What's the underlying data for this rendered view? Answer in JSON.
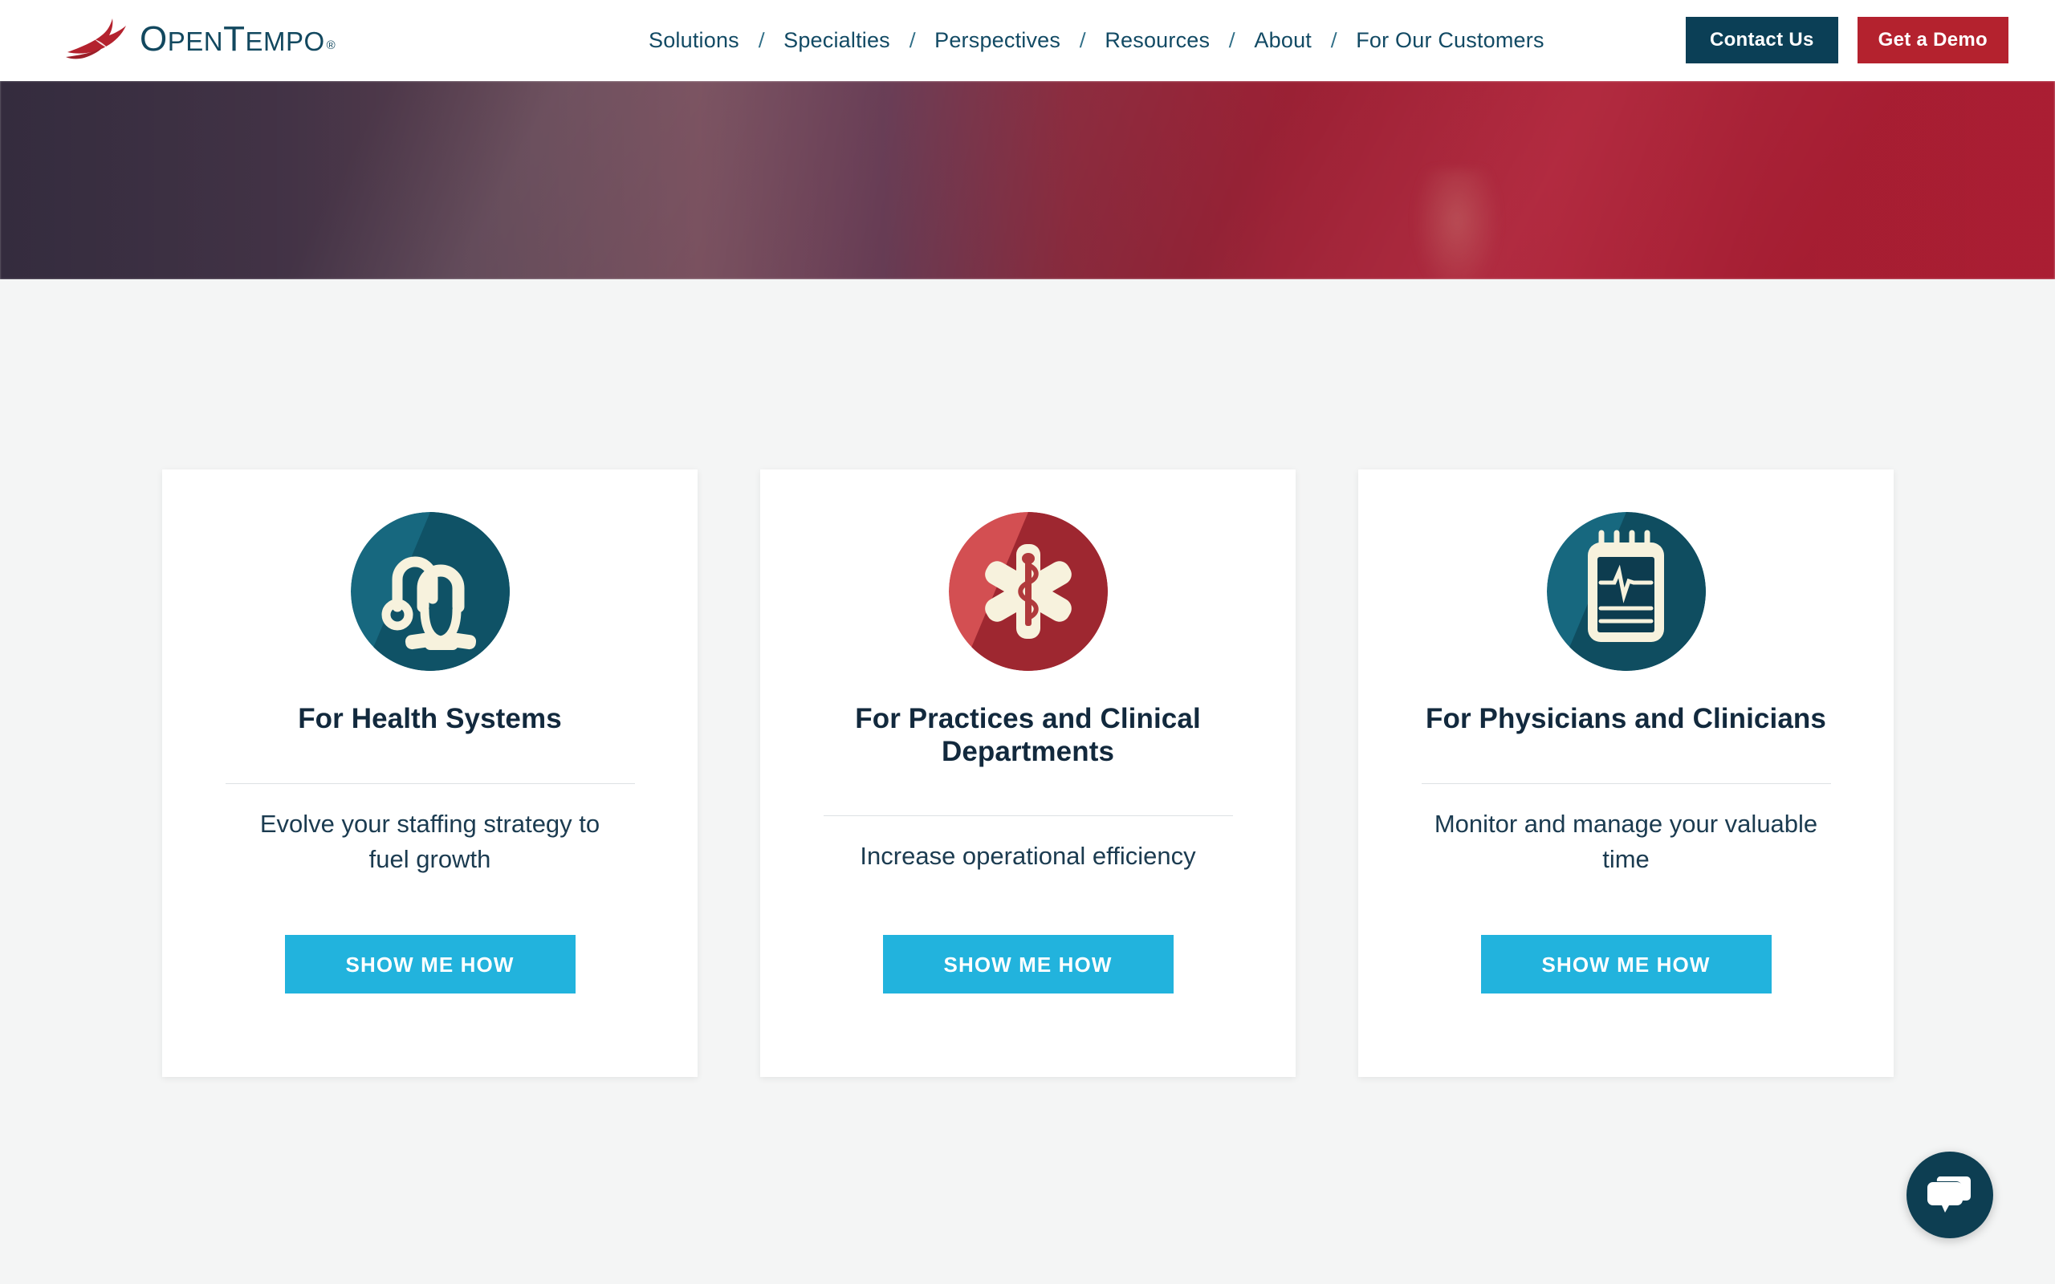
{
  "brand": {
    "logo_text_open": "O",
    "logo_text_pen": "PEN",
    "logo_text_t": "T",
    "logo_text_empo": "EMPO",
    "logo_registered": "®",
    "logo_name": "OpenTempo",
    "colors": {
      "navy": "#0b3f56",
      "crimson": "#b4222e",
      "cyan": "#22b3dd",
      "teal": "#17687f",
      "salmon": "#d34f52",
      "page_bg": "#f4f5f5",
      "title_navy": "#12293d"
    }
  },
  "header": {
    "nav": [
      {
        "label": "Solutions"
      },
      {
        "label": "Specialties"
      },
      {
        "label": "Perspectives"
      },
      {
        "label": "Resources"
      },
      {
        "label": "About"
      },
      {
        "label": "For Our Customers"
      }
    ],
    "separator": "/",
    "contact_button": "Contact Us",
    "demo_button": "Get a Demo"
  },
  "hero": {
    "overlay_start_color": "#3c3346",
    "overlay_end_color": "#b01f35"
  },
  "cards": [
    {
      "icon": "stethoscope-icon",
      "icon_circle_color": "#17687f",
      "icon_shadow_color": "#0f5266",
      "title": "For Health Systems",
      "description": "Evolve your staffing strategy to fuel growth",
      "cta": "SHOW ME HOW"
    },
    {
      "icon": "star-of-life-icon",
      "icon_circle_color": "#d34f52",
      "icon_shadow_color": "#9e2730",
      "title": "For Practices and Clinical Departments",
      "description": "Increase operational efficiency",
      "cta": "SHOW ME HOW"
    },
    {
      "icon": "clipboard-ekg-icon",
      "icon_circle_color": "#17687f",
      "icon_shadow_color": "#0f4d60",
      "title": "For Physicians and Clinicians",
      "description": "Monitor and manage your valuable time",
      "cta": "SHOW ME HOW"
    }
  ],
  "chat": {
    "icon": "chat-bubble-icon",
    "color": "#0d3e52"
  }
}
